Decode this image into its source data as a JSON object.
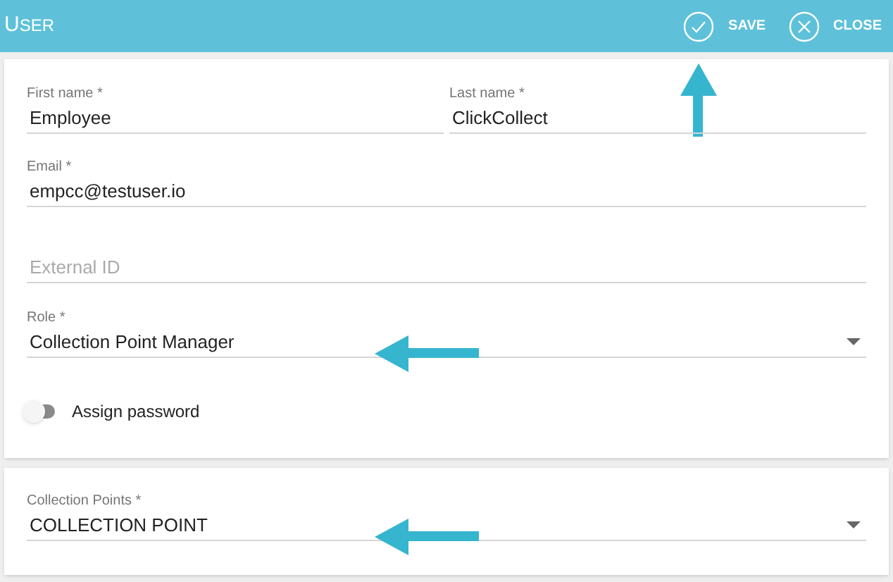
{
  "header": {
    "title": "USER",
    "actions": [
      {
        "kind": "save",
        "label": "SAVE",
        "arrow": true
      },
      {
        "kind": "close",
        "label": "CLOSE",
        "arrow": false
      }
    ]
  },
  "fields": [
    {
      "label": "First name *",
      "value": "Employee"
    },
    {
      "label": "Last name *",
      "value": "ClickCollect"
    },
    {
      "label": "Email *",
      "value": "empcc@testuser.io"
    },
    {
      "placeholder": "External ID"
    },
    {
      "label": "Role *",
      "value": "Collection Point Manager",
      "dropdown": true,
      "arrow": true
    }
  ],
  "toggle": {
    "label": "Assign password",
    "on": false
  },
  "collection_points": {
    "label": "Collection Points *",
    "value": "COLLECTION POINT",
    "dropdown": true,
    "arrow": true
  }
}
